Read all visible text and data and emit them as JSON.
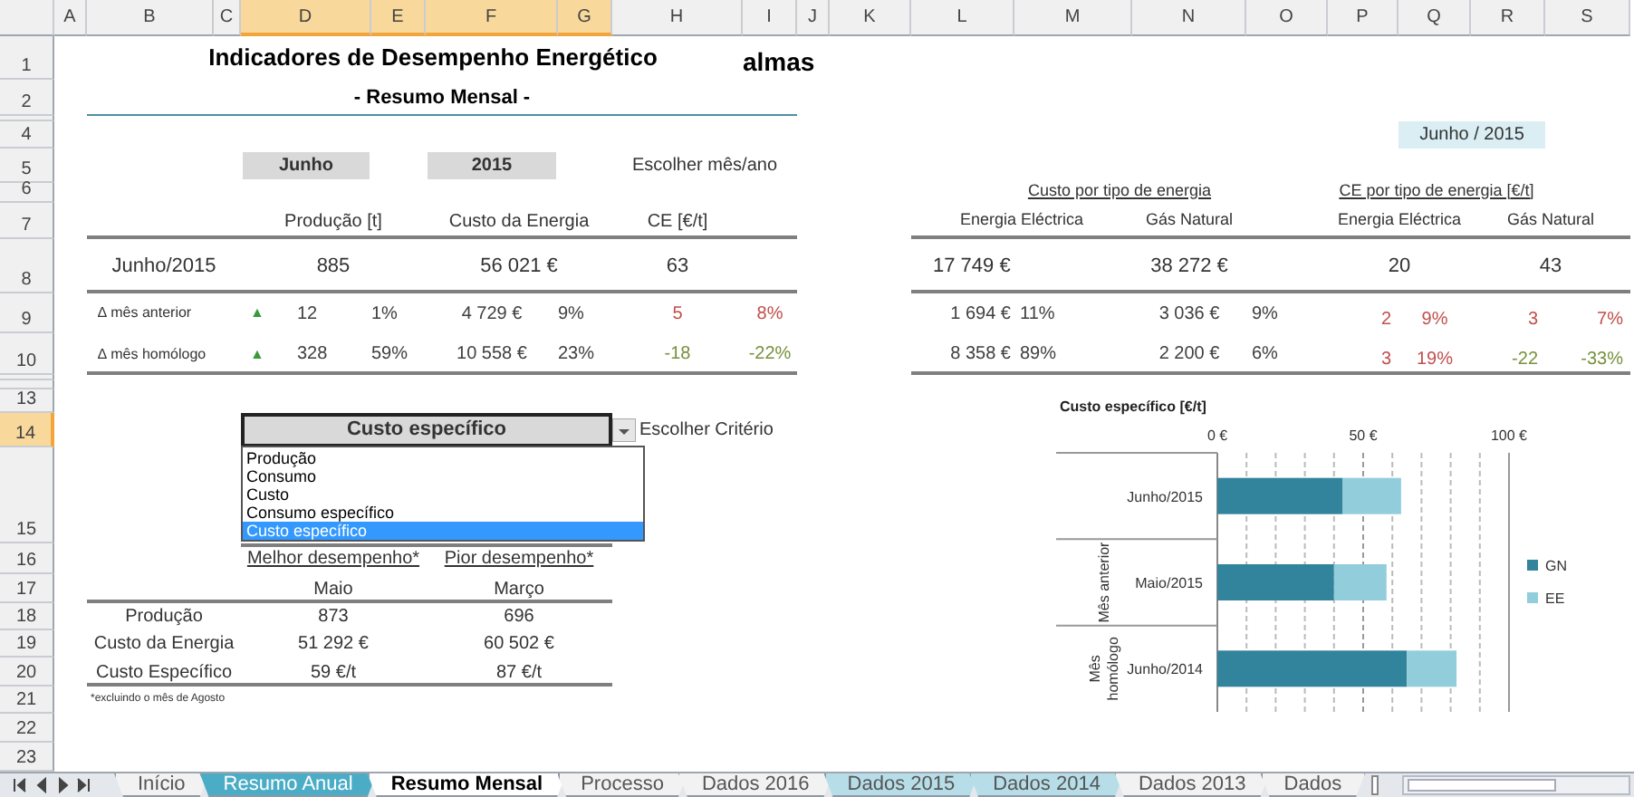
{
  "column_headers": [
    {
      "label": "A",
      "selected": false
    },
    {
      "label": "B",
      "selected": false
    },
    {
      "label": "C",
      "selected": false
    },
    {
      "label": "D",
      "selected": true
    },
    {
      "label": "E",
      "selected": true
    },
    {
      "label": "F",
      "selected": true
    },
    {
      "label": "G",
      "selected": true
    },
    {
      "label": "H",
      "selected": false
    },
    {
      "label": "I",
      "selected": false
    },
    {
      "label": "J",
      "selected": false
    },
    {
      "label": "K",
      "selected": false
    },
    {
      "label": "L",
      "selected": false
    },
    {
      "label": "M",
      "selected": false
    },
    {
      "label": "N",
      "selected": false
    },
    {
      "label": "O",
      "selected": false
    },
    {
      "label": "P",
      "selected": false
    },
    {
      "label": "Q",
      "selected": false
    },
    {
      "label": "R",
      "selected": false
    },
    {
      "label": "S",
      "selected": false
    }
  ],
  "row_headers": [
    {
      "label": "1",
      "selected": false
    },
    {
      "label": "2",
      "selected": false
    },
    {
      "label": "4",
      "selected": false
    },
    {
      "label": "5",
      "selected": false
    },
    {
      "label": "6",
      "selected": false
    },
    {
      "label": "7",
      "selected": false
    },
    {
      "label": "8",
      "selected": false
    },
    {
      "label": "9",
      "selected": false
    },
    {
      "label": "10",
      "selected": false
    },
    {
      "label": "13",
      "selected": false
    },
    {
      "label": "14",
      "selected": true
    },
    {
      "label": "15",
      "selected": false
    },
    {
      "label": "16",
      "selected": false
    },
    {
      "label": "17",
      "selected": false
    },
    {
      "label": "18",
      "selected": false
    },
    {
      "label": "19",
      "selected": false
    },
    {
      "label": "20",
      "selected": false
    },
    {
      "label": "21",
      "selected": false
    },
    {
      "label": "22",
      "selected": false
    },
    {
      "label": "23",
      "selected": false
    }
  ],
  "header": {
    "title": "Indicadores de Desempenho Energético",
    "subtitle": "- Resumo Mensal -",
    "logo": "almas"
  },
  "period_picker": {
    "month": "Junho",
    "year": "2015",
    "label": "Escolher mês/ano",
    "badge": "Junho / 2015"
  },
  "summary": {
    "columns": [
      "Produção [t]",
      "Custo da Energia",
      "CE [€/t]"
    ],
    "period": "Junho/2015",
    "values": [
      "885",
      "56 021 €",
      "63"
    ],
    "deltas": [
      {
        "label": "∆ mês anterior",
        "trend": "▲",
        "cells": [
          {
            "text": "12",
            "color": "#404040"
          },
          {
            "text": "1%",
            "color": "#404040"
          },
          {
            "text": "4 729 €",
            "color": "#404040"
          },
          {
            "text": "9%",
            "color": "#404040"
          },
          {
            "text": "5",
            "color": "#c0504d"
          },
          {
            "text": "8%",
            "color": "#c0504d"
          }
        ]
      },
      {
        "label": "∆ mês homólogo",
        "trend": "▲",
        "cells": [
          {
            "text": "328",
            "color": "#404040"
          },
          {
            "text": "59%",
            "color": "#404040"
          },
          {
            "text": "10 558 €",
            "color": "#404040"
          },
          {
            "text": "23%",
            "color": "#404040"
          },
          {
            "text": "-18",
            "color": "#76923c"
          },
          {
            "text": "-22%",
            "color": "#76923c"
          }
        ]
      }
    ]
  },
  "energy_breakdown": {
    "cost_title": "Custo por tipo de energia",
    "ce_title": "CE por tipo de energia [€/t]",
    "columns": [
      "Energia Eléctrica",
      "Gás Natural",
      "Energia Eléctrica",
      "Gás Natural"
    ],
    "values": [
      "17 749 €",
      "38 272 €",
      "20",
      "43"
    ],
    "deltas": [
      {
        "cells": [
          {
            "text": "1 694 €",
            "color": "#404040"
          },
          {
            "text": "11%",
            "color": "#404040"
          },
          {
            "text": "3 036 €",
            "color": "#404040"
          },
          {
            "text": "9%",
            "color": "#404040"
          },
          {
            "text": "2",
            "color": "#c0504d"
          },
          {
            "text": "9%",
            "color": "#c0504d"
          },
          {
            "text": "3",
            "color": "#c0504d"
          },
          {
            "text": "7%",
            "color": "#c0504d"
          }
        ]
      },
      {
        "cells": [
          {
            "text": "8 358 €",
            "color": "#404040"
          },
          {
            "text": "89%",
            "color": "#404040"
          },
          {
            "text": "2 200 €",
            "color": "#404040"
          },
          {
            "text": "6%",
            "color": "#404040"
          },
          {
            "text": "3",
            "color": "#c0504d"
          },
          {
            "text": "19%",
            "color": "#c0504d"
          },
          {
            "text": "-22",
            "color": "#76923c"
          },
          {
            "text": "-33%",
            "color": "#76923c"
          }
        ]
      }
    ]
  },
  "criterion": {
    "value": "Custo específico",
    "label": "Escolher Critério",
    "expanded": true,
    "options": [
      {
        "label": "Produção",
        "selected": false
      },
      {
        "label": "Consumo",
        "selected": false
      },
      {
        "label": "Custo",
        "selected": false
      },
      {
        "label": "Consumo específico",
        "selected": false
      },
      {
        "label": "Custo específico",
        "selected": true
      }
    ]
  },
  "performance": {
    "columns": [
      "Melhor desempenho*",
      "Pior desempenho*"
    ],
    "months": [
      "Maio",
      "Março"
    ],
    "rows": [
      {
        "label": "Produção",
        "values": [
          "873",
          "696"
        ]
      },
      {
        "label": "Custo da Energia",
        "values": [
          "51 292 €",
          "60 502 €"
        ]
      },
      {
        "label": "Custo Específico",
        "values": [
          "59 €/t",
          "87 €/t"
        ]
      }
    ],
    "footnote": "*excluindo o mês de Agosto"
  },
  "chart_panel": {
    "chart_data": {
      "type": "bar",
      "orientation": "horizontal",
      "stacked": true,
      "title": "Custo específico [€/t]",
      "categories": [
        "Junho/2015",
        "Maio/2015",
        "Junho/2014"
      ],
      "series": [
        {
          "name": "GN",
          "color": "#31849b",
          "values": [
            43,
            40,
            65
          ]
        },
        {
          "name": "EE",
          "color": "#92cddc",
          "values": [
            20,
            18,
            17
          ]
        }
      ],
      "xlim": [
        0,
        100
      ],
      "xticks": [
        {
          "value": 0,
          "label": "0 €"
        },
        {
          "value": 50,
          "label": "50 €"
        },
        {
          "value": 100,
          "label": "100 €"
        }
      ],
      "legend": "right",
      "annotations": [
        "Mês anterior",
        "Mês homólogo"
      ]
    }
  },
  "sheet_tabs": [
    {
      "label": "Início",
      "selected": false,
      "color": "#f2f2f2"
    },
    {
      "label": "Resumo Anual",
      "selected": false,
      "color": "#4bacc6"
    },
    {
      "label": "Resumo Mensal",
      "selected": true,
      "color": "#ffffff"
    },
    {
      "label": "Processo",
      "selected": false,
      "color": "#f2f2f2"
    },
    {
      "label": "Dados 2016",
      "selected": false,
      "color": "#f2f2f2"
    },
    {
      "label": "Dados 2015",
      "selected": false,
      "color": "#b7dee8"
    },
    {
      "label": "Dados 2014",
      "selected": false,
      "color": "#b7dee8"
    },
    {
      "label": "Dados 2013",
      "selected": false,
      "color": "#f2f2f2"
    },
    {
      "label": "Dados",
      "selected": false,
      "color": "#f2f2f2"
    }
  ]
}
